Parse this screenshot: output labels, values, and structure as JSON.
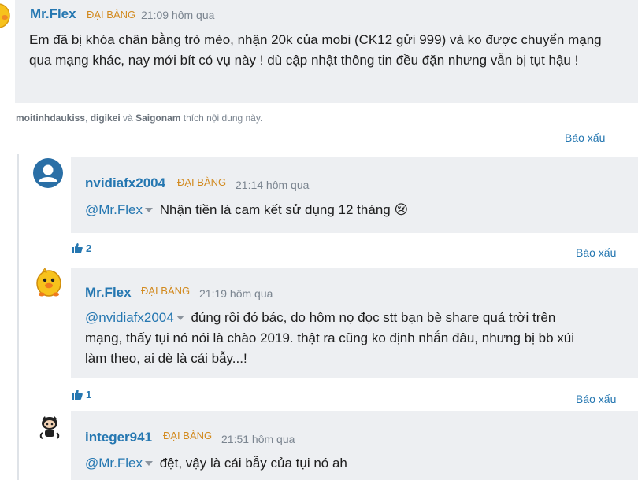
{
  "comments": [
    {
      "author": "Mr.Flex",
      "rank": "ĐẠI BÀNG",
      "time": "21:09 hôm qua",
      "text": "Em đã bị khóa chân bằng trò mèo, nhận 20k của mobi (CK12 gửi 999) và ko được chuyển mạng qua mạng khác, nay mới bít có vụ này ! dù cập nhật thông tin đều đặn nhưng vẫn bị tụt hậu !",
      "likers": [
        "moitinhdaukiss",
        "digikei",
        "Saigonam"
      ],
      "likers_sep1": ", ",
      "likers_and": "và",
      "likers_suffix": "thích nội dung này.",
      "report": "Báo xấu"
    },
    {
      "author": "nvidiafx2004",
      "rank": "ĐẠI BÀNG",
      "time": "21:14 hôm qua",
      "mention": "@Mr.Flex",
      "text": "Nhận tiền là cam kết sử dụng 12 tháng",
      "emoji": "😢",
      "likes": "2",
      "report": "Báo xấu"
    },
    {
      "author": "Mr.Flex",
      "rank": "ĐẠI BÀNG",
      "time": "21:19 hôm qua",
      "mention": "@nvidiafx2004",
      "text": "đúng rồi đó bác, do hôm nọ đọc stt bạn bè share quá trời trên mạng, thấy tụi nó nói là chào 2019. thật ra cũng ko định nhắn đâu, nhưng bị bb xúi làm theo, ai dè là cái bẫy...!",
      "likes": "1",
      "report": "Báo xấu"
    },
    {
      "author": "integer941",
      "rank": "ĐẠI BÀNG",
      "time": "21:51 hôm qua",
      "mention": "@Mr.Flex",
      "text": "đệt, vậy là cái bẫy của tụi nó ah"
    }
  ],
  "colors": {
    "link": "#2577b1",
    "rank": "#d28a1f",
    "bubble": "#edeff2",
    "muted": "#7b8590"
  },
  "icons": [
    "user-avatar-icon",
    "chick-avatar-icon",
    "octocat-avatar-icon",
    "thumbs-up-icon",
    "caret-down-icon"
  ]
}
